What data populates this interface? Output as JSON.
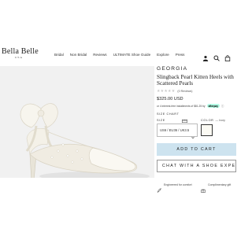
{
  "header": {
    "logo_name": "Bella Belle",
    "logo_sub": "USA",
    "nav": [
      "Bridal",
      "Non Bridal",
      "Reviews",
      "ULTIMATE Shoe Guide",
      "Explore",
      "Press"
    ],
    "icons": [
      "user-icon",
      "search-icon",
      "bag-icon"
    ]
  },
  "product": {
    "brand": "GEORGIA",
    "title": "Slingback Pearl Kitten Heels with Scattered Pearls",
    "stars": "★★★★★",
    "review_count": "(0 Reviews)",
    "price": "$325.00 USD",
    "installments_text": "or 4 interest-free installments of $81.25 by",
    "afterpay_label": "afterpay",
    "info_icon": "ⓘ",
    "size_chart_label": "SIZE CHART",
    "size_label": "SIZE",
    "size_value": "US6 / EU36 / UK3.5",
    "color_label": "COLOR",
    "color_value": "— Ivory",
    "color_swatch": "#fbfaf3"
  },
  "actions": {
    "add_to_cart": "ADD TO CART",
    "chat": "CHAT WITH A SHOE EXPERT"
  },
  "features": {
    "left": "Engineered for comfort",
    "right": "Complimentary gift"
  },
  "colors": {
    "cart_button": "#cde3ef",
    "photo_bg": "#f2f2f2"
  }
}
